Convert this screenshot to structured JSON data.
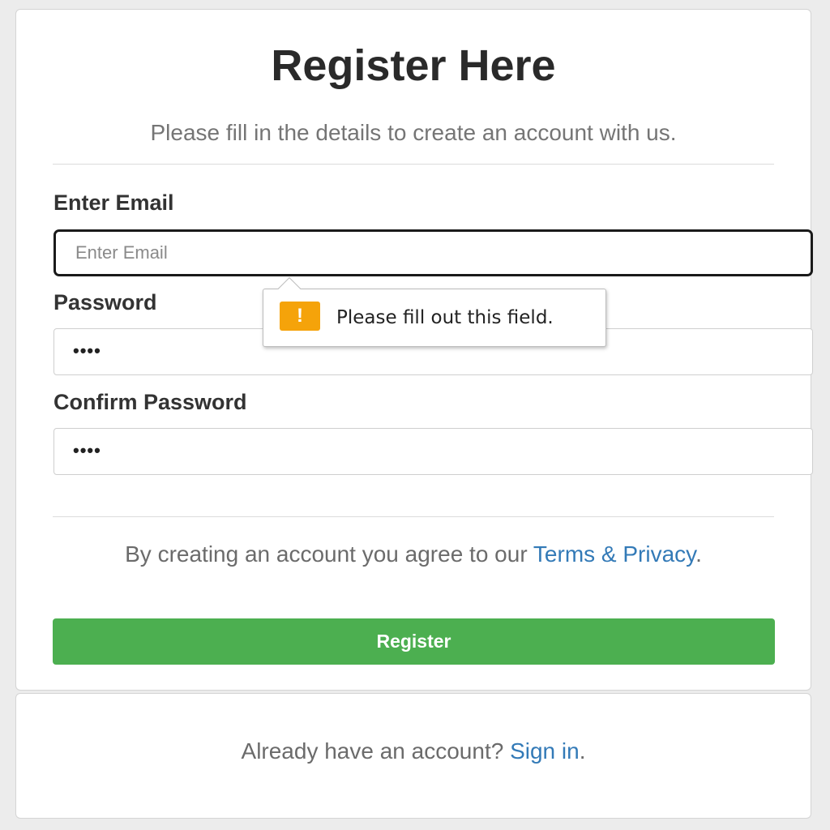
{
  "form": {
    "title": "Register Here",
    "subtitle": "Please fill in the details to create an account with us.",
    "email": {
      "label": "Enter Email",
      "placeholder": "Enter Email",
      "value": ""
    },
    "password": {
      "label": "Password",
      "masked_value": "••••"
    },
    "confirm_password": {
      "label": "Confirm Password",
      "masked_value": "••••"
    },
    "validation_tooltip": {
      "icon": "warning-icon",
      "icon_glyph": "!",
      "message": "Please fill out this field."
    },
    "agreement": {
      "text": "By creating an account you agree to our ",
      "link": "Terms & Privacy",
      "end": "."
    },
    "register_label": "Register"
  },
  "footer": {
    "text": "Already have an account? ",
    "link": "Sign in",
    "end": "."
  },
  "colors": {
    "accent_green": "#4caf50",
    "link_blue": "#337ab7",
    "warning_orange": "#f5a30a"
  }
}
